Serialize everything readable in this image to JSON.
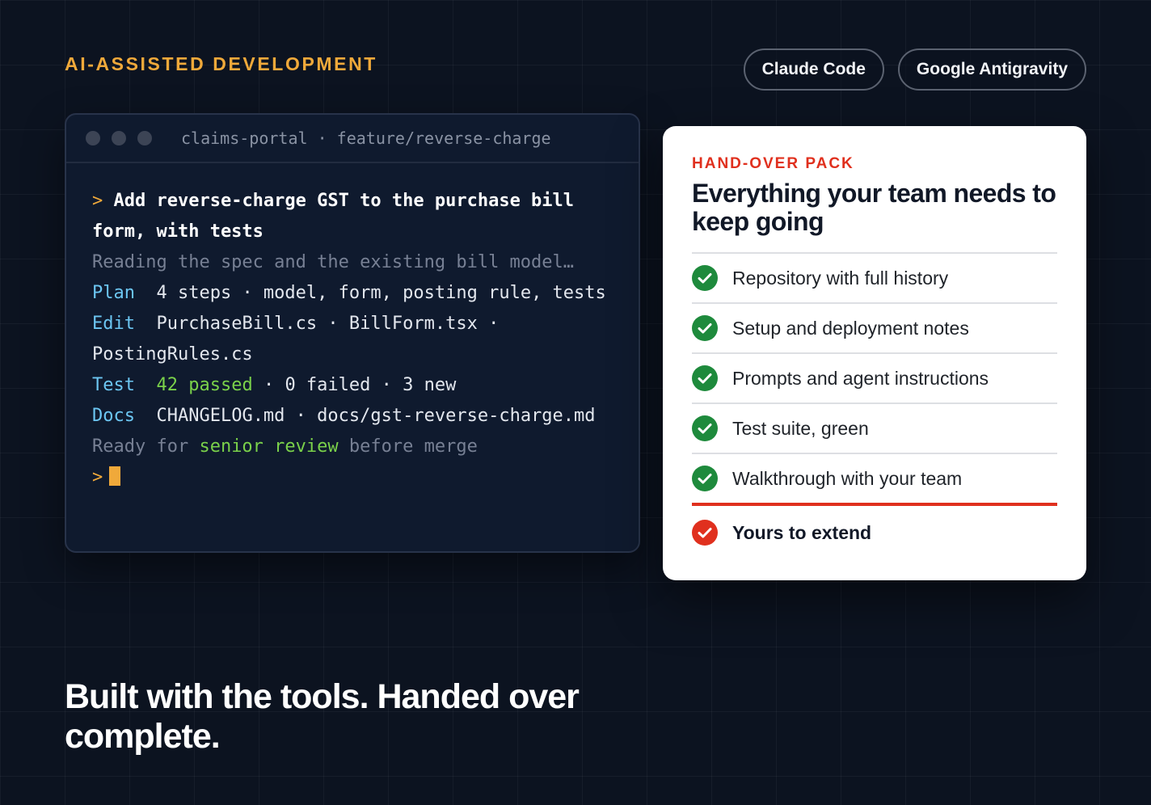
{
  "eyebrow": "AI-ASSISTED DEVELOPMENT",
  "tools": [
    "Claude Code",
    "Google Antigravity"
  ],
  "terminal": {
    "title": "claims-portal · feature/reverse-charge",
    "prompt_symbol": ">",
    "command": "Add reverse-charge GST to the purchase bill form, with tests",
    "reading": "Reading the spec and the existing bill model…",
    "plan_key": "Plan",
    "plan_text": "4 steps · model, form, posting rule, tests",
    "edit_key": "Edit",
    "edit_text": "PurchaseBill.cs · BillForm.tsx · PostingRules.cs",
    "test_key": "Test",
    "test_passed": "42 passed",
    "test_rest": " · 0 failed · 3 new",
    "docs_key": "Docs",
    "docs_text": "CHANGELOG.md · docs/gst-reverse-charge.md",
    "ready_pre": "Ready for ",
    "ready_highlight": "senior review",
    "ready_post": " before merge"
  },
  "card": {
    "eyebrow": "HAND-OVER PACK",
    "title": "Everything your team needs to keep going",
    "items": [
      "Repository with full history",
      "Setup and deployment notes",
      "Prompts and agent instructions",
      "Test suite, green",
      "Walkthrough with your team"
    ],
    "final_item": "Yours to extend",
    "colors": {
      "accent_red": "#e0301e",
      "check_green": "#1e8a3c"
    }
  },
  "headline": "Built with the tools. Handed over complete.",
  "colors": {
    "accent_orange": "#f0a93a",
    "background": "#0c1320"
  }
}
